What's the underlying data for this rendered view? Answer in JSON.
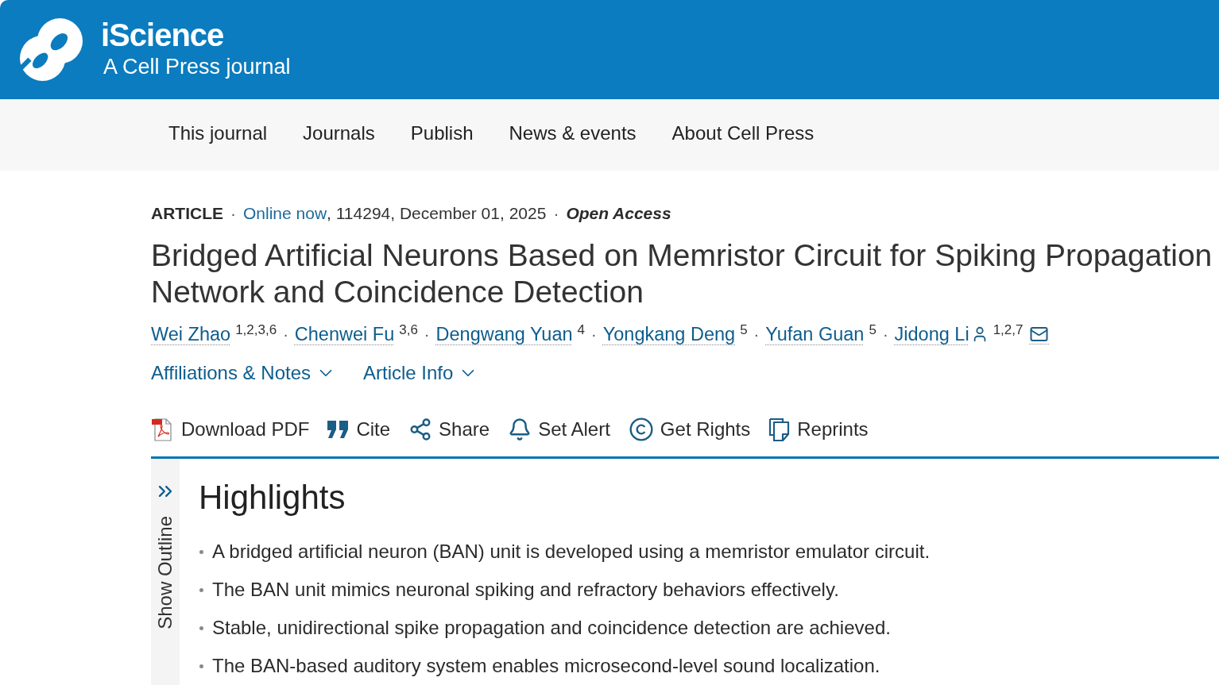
{
  "header": {
    "title": "iScience",
    "subtitle": "A Cell Press journal"
  },
  "nav": [
    {
      "label": "This journal"
    },
    {
      "label": "Journals"
    },
    {
      "label": "Publish"
    },
    {
      "label": "News & events"
    },
    {
      "label": "About Cell Press"
    }
  ],
  "article": {
    "meta": [
      {
        "kind": "label",
        "text": "ARTICLE"
      },
      {
        "kind": "separator",
        "text": "·"
      },
      {
        "kind": "link",
        "text": "Online now"
      },
      {
        "kind": "plain",
        "text": ", 114294, December 01, 2025"
      },
      {
        "kind": "separator",
        "text": "·"
      },
      {
        "kind": "access",
        "text": "Open Access"
      }
    ],
    "title": "Bridged Artificial Neurons Based on Memristor Circuit for Spiking Propagation Network and Coincidence Detection",
    "authors": [
      {
        "name": "Wei Zhao",
        "affiliations": "1,2,3,6",
        "corresponding": false
      },
      {
        "separator": "·",
        "name": "Chenwei Fu",
        "affiliations": "3,6",
        "corresponding": false
      },
      {
        "separator": "·",
        "name": "Dengwang Yuan",
        "affiliations": "4",
        "corresponding": false
      },
      {
        "separator": "·",
        "name": "Yongkang Deng",
        "affiliations": "5",
        "corresponding": false
      },
      {
        "separator": "·",
        "name": "Yufan Guan",
        "affiliations": "5",
        "corresponding": false
      },
      {
        "separator": "·",
        "name": "Jidong Li",
        "affiliations": "1,2,7",
        "corresponding": true
      }
    ],
    "toggles": [
      {
        "label": "Affiliations & Notes",
        "expanded": false
      },
      {
        "label": "Article Info",
        "expanded": false
      }
    ],
    "actions": [
      {
        "label": "Download PDF"
      },
      {
        "label": "Cite"
      },
      {
        "label": "Share"
      },
      {
        "label": "Set Alert"
      },
      {
        "label": "Get Rights"
      },
      {
        "label": "Reprints"
      }
    ]
  },
  "outline": {
    "label": "Show Outline"
  },
  "highlights": {
    "heading": "Highlights",
    "items": [
      "A bridged artificial neuron (BAN) unit is developed using a memristor emulator circuit.",
      "The BAN unit mimics neuronal spiking and refractory behaviors effectively.",
      "Stable, unidirectional spike propagation and coincidence detection are achieved.",
      "The BAN-based auditory system enables microsecond-level sound localization."
    ]
  }
}
